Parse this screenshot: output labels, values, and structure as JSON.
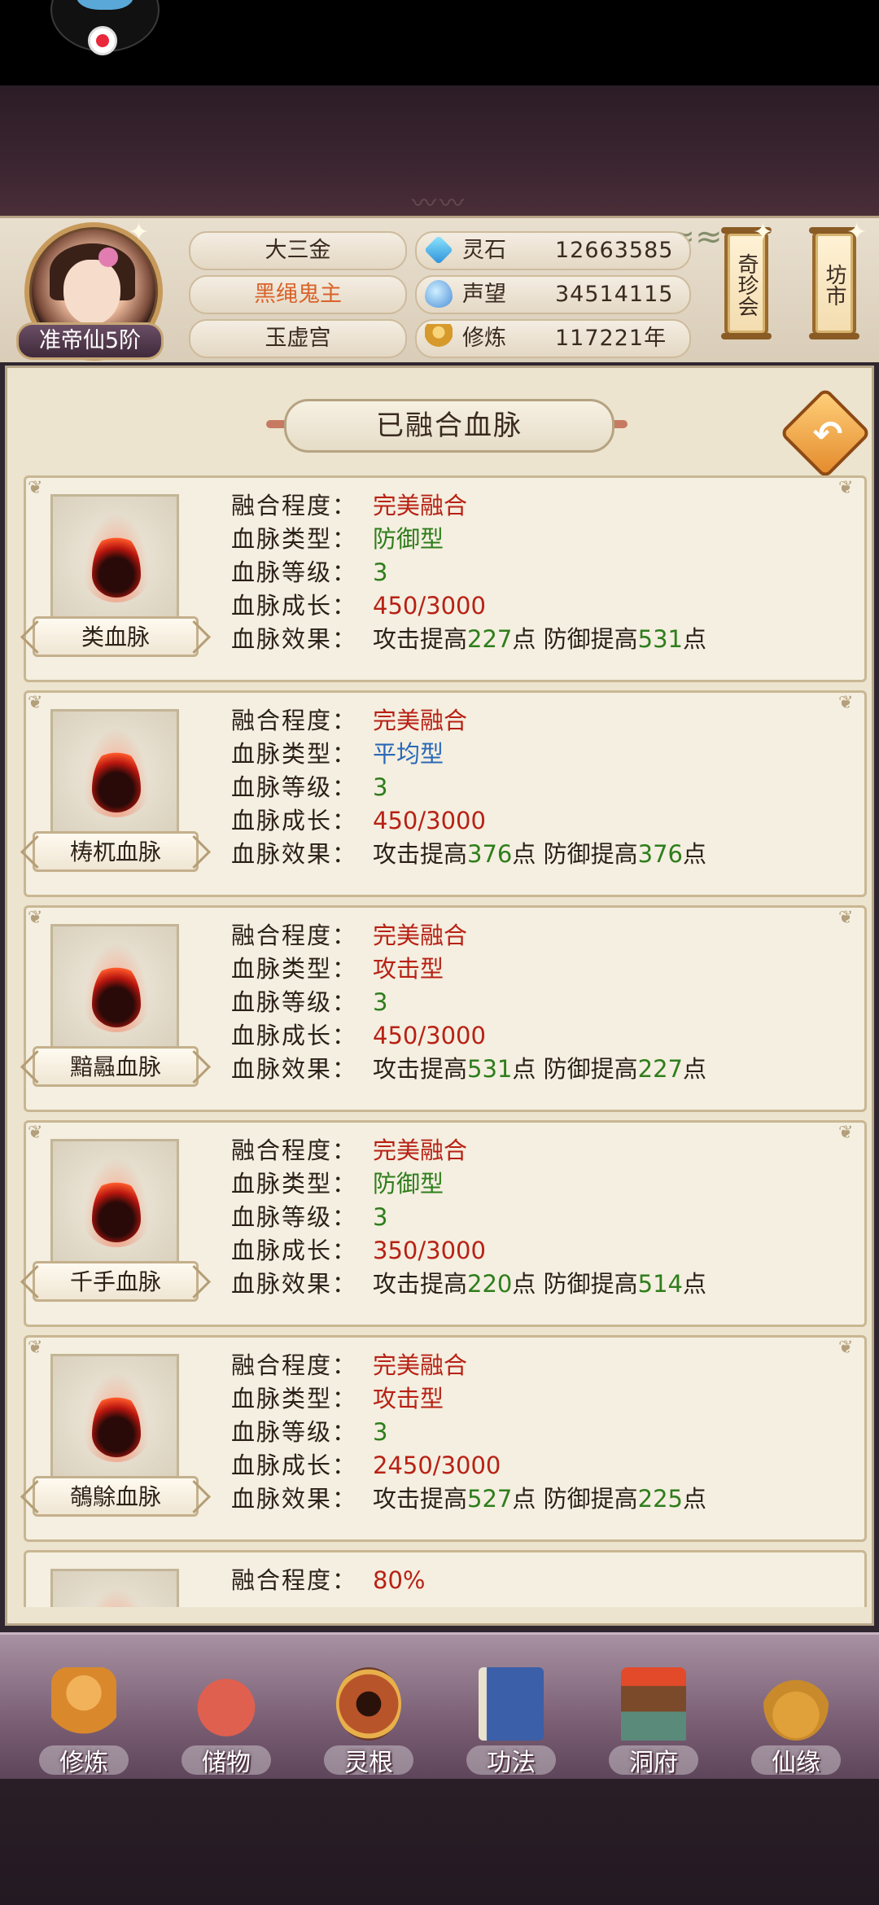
{
  "header": {
    "rank": "准帝仙5阶",
    "names": [
      "大三金",
      "黑绳鬼主",
      "玉虚宫"
    ],
    "resources": [
      {
        "icon": "spirit-stone-icon",
        "label": "灵石",
        "value": "12663585"
      },
      {
        "icon": "prestige-icon",
        "label": "声望",
        "value": "34514115"
      },
      {
        "icon": "cultivation-icon",
        "label": "修炼",
        "value": "117221年"
      }
    ],
    "side_buttons": [
      "奇珍会",
      "坊市"
    ]
  },
  "panel": {
    "title": "已融合血脉",
    "labels": {
      "fusion": "融合程度：",
      "type": "血脉类型：",
      "level": "血脉等级：",
      "growth": "血脉成长：",
      "effect": "血脉效果："
    },
    "effect_words": {
      "atk": "攻击提高",
      "def": "防御提高",
      "unit": "点"
    }
  },
  "bloodlines": [
    {
      "name": "类血脉",
      "fusion": "完美融合",
      "type": "防御型",
      "type_color": "green",
      "level": "3",
      "growth": "450/3000",
      "atk": "227",
      "def": "531"
    },
    {
      "name": "梼杌血脉",
      "fusion": "完美融合",
      "type": "平均型",
      "type_color": "blue",
      "level": "3",
      "growth": "450/3000",
      "atk": "376",
      "def": "376"
    },
    {
      "name": "黯曧血脉",
      "fusion": "完美融合",
      "type": "攻击型",
      "type_color": "red",
      "level": "3",
      "growth": "450/3000",
      "atk": "531",
      "def": "227"
    },
    {
      "name": "千手血脉",
      "fusion": "完美融合",
      "type": "防御型",
      "type_color": "green",
      "level": "3",
      "growth": "350/3000",
      "atk": "220",
      "def": "514"
    },
    {
      "name": "鵸鵌血脉",
      "fusion": "完美融合",
      "type": "攻击型",
      "type_color": "red",
      "level": "3",
      "growth": "2450/3000",
      "atk": "527",
      "def": "225"
    },
    {
      "name": "",
      "fusion": "80%"
    }
  ],
  "bottom_nav": [
    {
      "label": "修炼",
      "icon": "cultivate-monk-icon",
      "color": "#d9892c"
    },
    {
      "label": "储物",
      "icon": "storage-bag-icon",
      "color": "#c4473a"
    },
    {
      "label": "灵根",
      "icon": "spirit-root-icon",
      "color": "#b8542a"
    },
    {
      "label": "功法",
      "icon": "technique-book-icon",
      "color": "#3b5fa8"
    },
    {
      "label": "洞府",
      "icon": "cave-palace-icon",
      "color": "#7a4a2a"
    },
    {
      "label": "仙缘",
      "icon": "gourd-yinyang-icon",
      "color": "#c98a2c"
    }
  ]
}
